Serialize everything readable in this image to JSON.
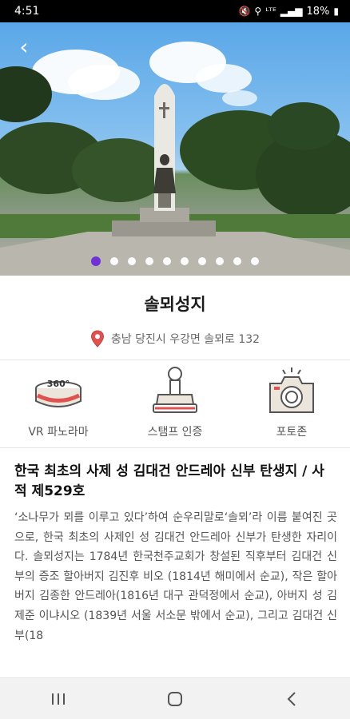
{
  "status_bar": {
    "time": "4:51",
    "icons": [
      "mute-icon",
      "location-icon",
      "lte-icon",
      "signal-icon"
    ],
    "battery": "18%"
  },
  "hero": {
    "image_description": "stone memorial cross monument with statue, pine trees, blue sky",
    "slide_count": 10,
    "active_slide": 1
  },
  "place": {
    "title": "솔뫼성지",
    "address": "충남 당진시 우강면 솔뫼로 132"
  },
  "actions": [
    {
      "label": "VR 파노라마",
      "icon": "vr-360-icon"
    },
    {
      "label": "스탬프 인증",
      "icon": "stamp-icon"
    },
    {
      "label": "포토존",
      "icon": "camera-icon"
    }
  ],
  "description": {
    "heading": "한국 최초의 사제 성 김대건 안드레아 신부 탄생지 / 사적 제529호",
    "body": "‘소나무가 뫼를 이루고 있다’하여 순우리말로‘솔뫼’라 이름 붙여진 곳으로, 한국 최초의 사제인 성 김대건 안드레아 신부가 탄생한 자리이다. 솔뫼성지는 1784년 한국천주교회가 창설된 직후부터 김대건 신부의 증조 할아버지 김진후 비오 (1814년 해미에서 순교), 작은 할아버지 김종한 안드레아(1816년 대구 관덕정에서 순교), 아버지 성 김제준 이냐시오 (1839년 서울 서소문 밖에서 순교), 그리고 김대건 신부(18"
  },
  "colors": {
    "accent": "#6b2bd9",
    "pin": "#e0524f"
  }
}
